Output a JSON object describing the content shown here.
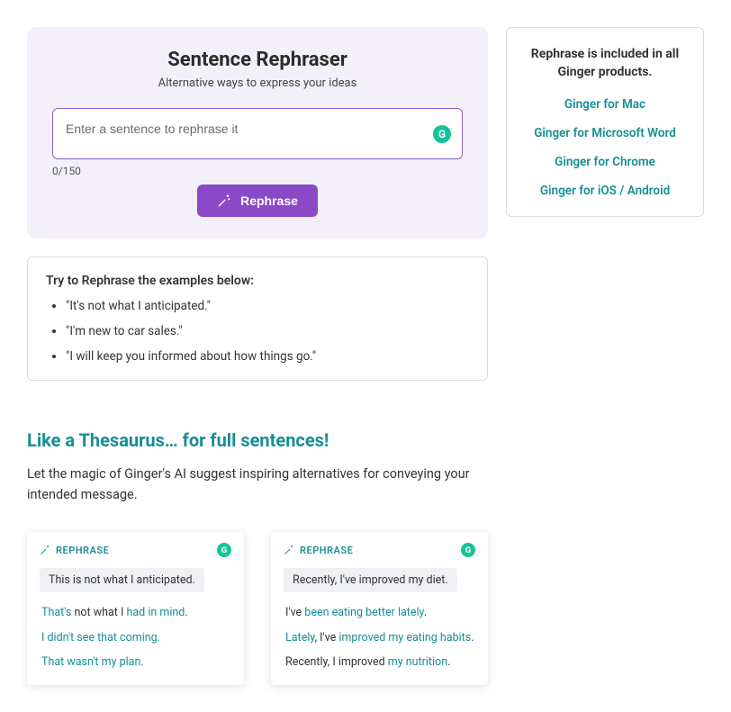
{
  "panel": {
    "title": "Sentence Rephraser",
    "subtitle": "Alternative ways to express your ideas",
    "placeholder": "Enter a sentence to rephrase it",
    "charCount": "0/150",
    "buttonLabel": "Rephrase",
    "badge": "G"
  },
  "examples": {
    "title": "Try to Rephrase the examples below:",
    "items": [
      "\"It's not what I anticipated.\"",
      "\"I'm new to car sales.\"",
      "\"I will keep you informed about how things go.\""
    ]
  },
  "section": {
    "heading": "Like a Thesaurus… for full sentences!",
    "text": "Let the magic of Ginger's AI suggest inspiring alternatives for conveying your intended message."
  },
  "previews": [
    {
      "headerLabel": "REPHRASE",
      "badge": "G",
      "input": "This is not what I anticipated.",
      "suggestions": [
        [
          {
            "t": "That's ",
            "h": true
          },
          {
            "t": "not what I ",
            "h": false
          },
          {
            "t": "had in mind",
            "h": true
          },
          {
            "t": ".",
            "h": false
          }
        ],
        [
          {
            "t": "I didn't see that coming.",
            "h": true
          }
        ],
        [
          {
            "t": "That wasn't my plan.",
            "h": true
          }
        ]
      ]
    },
    {
      "headerLabel": "REPHRASE",
      "badge": "G",
      "input": "Recently, I've improved my diet.",
      "suggestions": [
        [
          {
            "t": "I've ",
            "h": false
          },
          {
            "t": "been eating better lately",
            "h": true
          },
          {
            "t": ".",
            "h": false
          }
        ],
        [
          {
            "t": "Lately",
            "h": true
          },
          {
            "t": ", I've ",
            "h": false
          },
          {
            "t": "improved my eating habits",
            "h": true
          },
          {
            "t": ".",
            "h": false
          }
        ],
        [
          {
            "t": "Recently, I improved ",
            "h": false
          },
          {
            "t": "my nutrition",
            "h": true
          },
          {
            "t": ".",
            "h": false
          }
        ]
      ]
    }
  ],
  "sidebar": {
    "title": "Rephrase is included in all Ginger products.",
    "links": [
      "Ginger for Mac",
      "Ginger for Microsoft Word",
      "Ginger for Chrome",
      "Ginger for iOS / Android"
    ]
  }
}
